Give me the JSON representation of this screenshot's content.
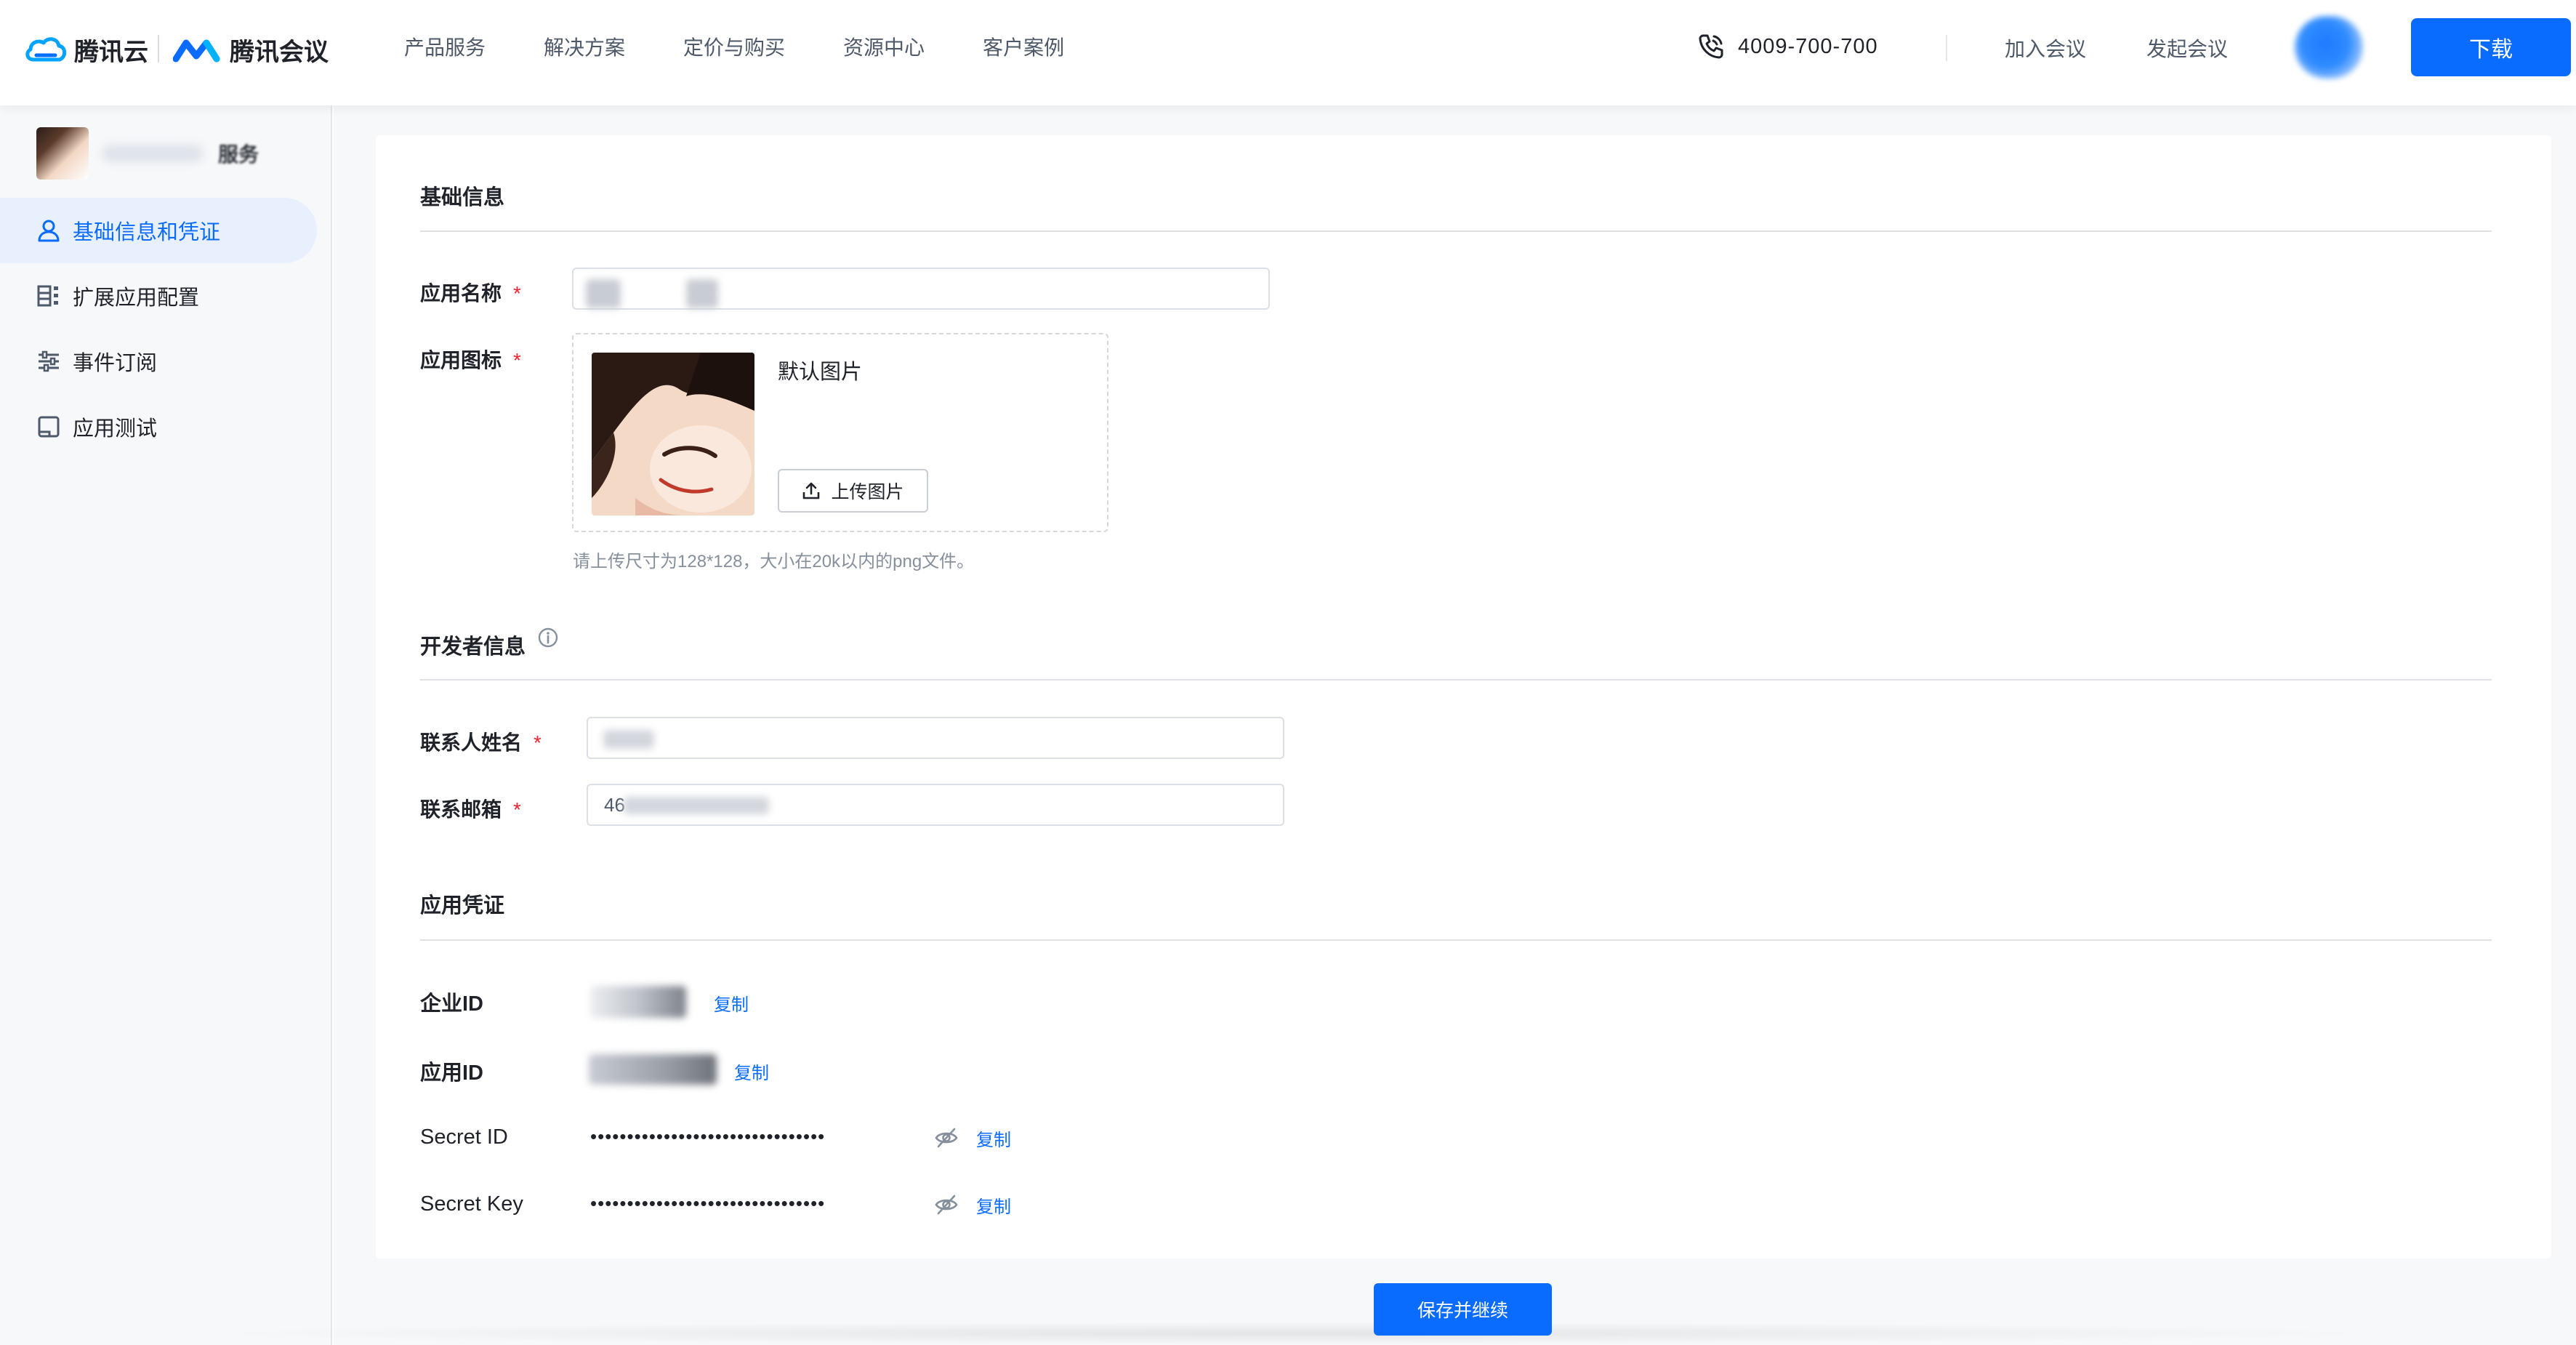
{
  "header": {
    "brand_cloud": "腾讯云",
    "brand_meeting": "腾讯会议",
    "nav": [
      "产品服务",
      "解决方案",
      "定价与购买",
      "资源中心",
      "客户案例"
    ],
    "phone": "4009-700-700",
    "join": "加入会议",
    "host": "发起会议",
    "download": "下载",
    "colors": {
      "accent": "#0a6cff"
    }
  },
  "sidebar": {
    "app_tag": "服务",
    "items": [
      {
        "label": "基础信息和凭证",
        "icon": "user-icon",
        "active": true
      },
      {
        "label": "扩展应用配置",
        "icon": "grid-list-icon",
        "active": false
      },
      {
        "label": "事件订阅",
        "icon": "sliders-icon",
        "active": false
      },
      {
        "label": "应用测试",
        "icon": "device-icon",
        "active": false
      }
    ]
  },
  "basic": {
    "title": "基础信息",
    "app_name_label": "应用名称",
    "app_icon_label": "应用图标",
    "default_image": "默认图片",
    "upload_button": "上传图片",
    "upload_hint": "请上传尺寸为128*128，大小在20k以内的png文件。"
  },
  "developer": {
    "title": "开发者信息",
    "contact_name_label": "联系人姓名",
    "contact_email_label": "联系邮箱",
    "contact_email_value_prefix": "46"
  },
  "credentials": {
    "title": "应用凭证",
    "enterprise_id_label": "企业ID",
    "app_id_label": "应用ID",
    "secret_id_label": "Secret ID",
    "secret_key_label": "Secret Key",
    "secret_id_masked": "••••••••••••••••••••••••••••••••",
    "secret_key_masked": "••••••••••••••••••••••••••••••••",
    "copy": "复制"
  },
  "footer": {
    "save_button": "保存并继续"
  }
}
